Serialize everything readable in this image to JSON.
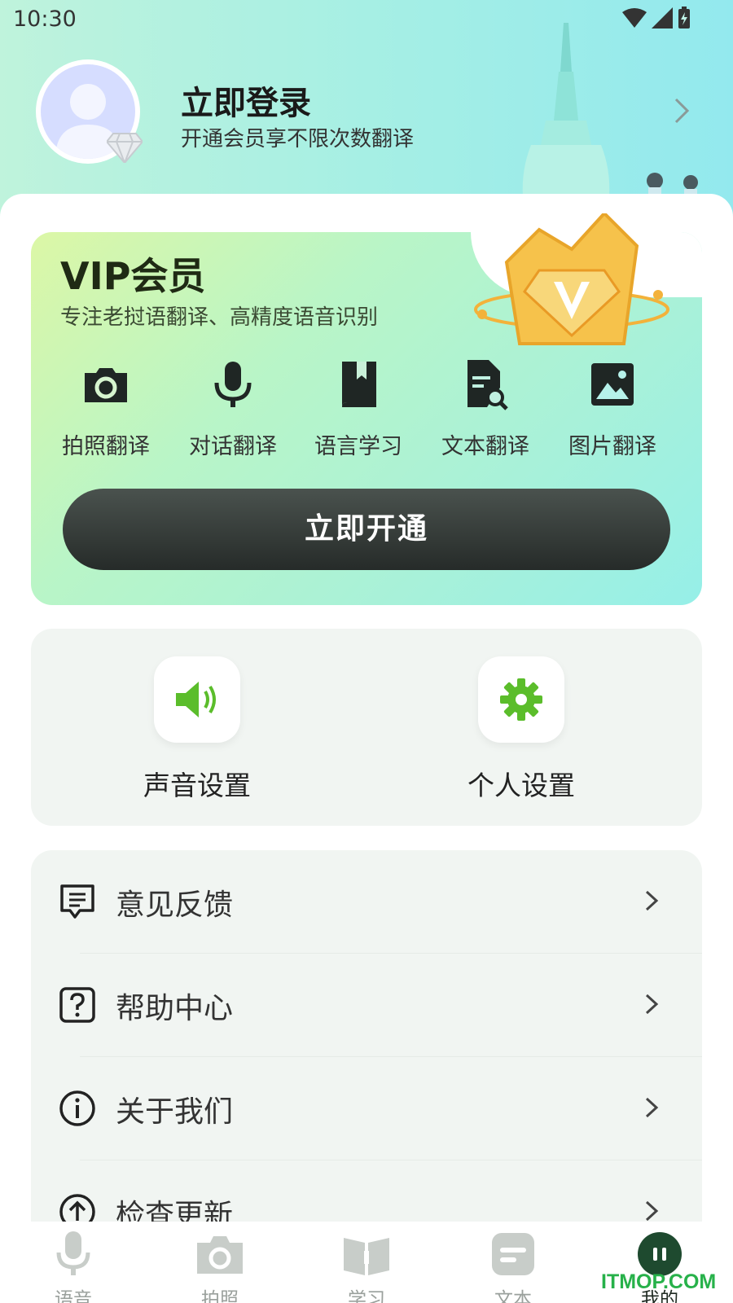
{
  "status_bar": {
    "time": "10:30"
  },
  "profile": {
    "login_title": "立即登录",
    "login_subtitle": "开通会员享不限次数翻译"
  },
  "vip": {
    "title": "VIP会员",
    "subtitle": "专注老挝语翻译、高精度语音识别",
    "features": [
      {
        "icon": "camera-icon",
        "label": "拍照翻译"
      },
      {
        "icon": "microphone-icon",
        "label": "对话翻译"
      },
      {
        "icon": "book-icon",
        "label": "语言学习"
      },
      {
        "icon": "document-search-icon",
        "label": "文本翻译"
      },
      {
        "icon": "image-icon",
        "label": "图片翻译"
      }
    ],
    "open_button": "立即开通"
  },
  "settings": [
    {
      "icon": "speaker-icon",
      "label": "声音设置"
    },
    {
      "icon": "gear-icon",
      "label": "个人设置"
    }
  ],
  "menu": [
    {
      "icon": "feedback-icon",
      "label": "意见反馈"
    },
    {
      "icon": "help-icon",
      "label": "帮助中心"
    },
    {
      "icon": "info-icon",
      "label": "关于我们"
    },
    {
      "icon": "update-icon",
      "label": "检查更新"
    }
  ],
  "nav": [
    {
      "icon": "microphone-icon",
      "label": "语音",
      "active": false
    },
    {
      "icon": "camera-icon",
      "label": "拍照",
      "active": false
    },
    {
      "icon": "book-icon",
      "label": "学习",
      "active": false
    },
    {
      "icon": "text-icon",
      "label": "文本",
      "active": false
    },
    {
      "icon": "profile-icon",
      "label": "我的",
      "active": true
    }
  ],
  "watermark": "ITMOP.COM",
  "colors": {
    "accent_green": "#5bbd2b",
    "dark_button": "#2e3431",
    "hero_start": "#bff3dc",
    "hero_end": "#93e9ee"
  }
}
